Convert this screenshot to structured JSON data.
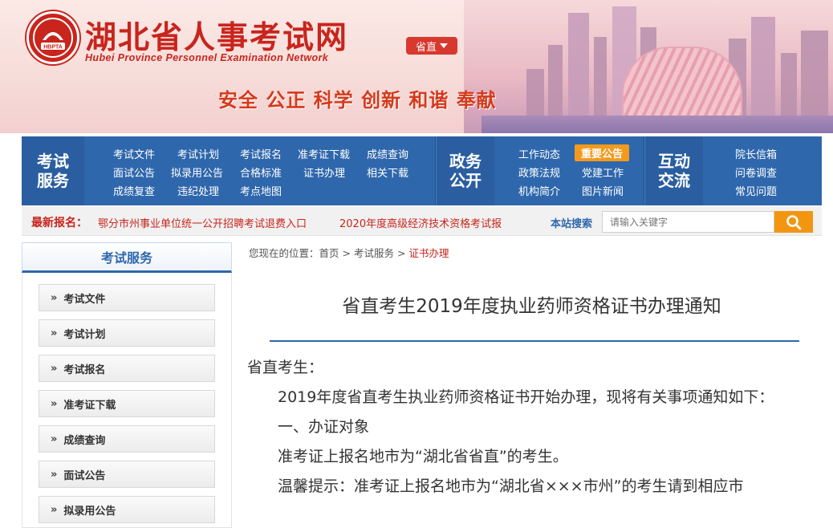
{
  "header": {
    "site_title": "湖北省人事考试网",
    "site_subtitle": "Hubei Province Personnel Examination Network",
    "logo_text": "HBPTA",
    "region_button": "省直",
    "slogan": "安全 公正 科学 创新 和谐 奉献"
  },
  "nav": {
    "groups": [
      {
        "heading": "考试服务",
        "links": [
          "考试文件",
          "考试计划",
          "考试报名",
          "准考证下载",
          "成绩查询",
          "面试公告",
          "拟录用公告",
          "合格标准",
          "证书办理",
          "相关下载",
          "成绩复查",
          "违纪处理",
          "考点地图"
        ]
      },
      {
        "heading": "政务公开",
        "links": [
          "工作动态",
          "重要公告",
          "政策法规",
          "党建工作",
          "机构简介",
          "图片新闻"
        ]
      },
      {
        "heading": "互动交流",
        "links": [
          "院长信箱",
          "问卷调查",
          "常见问题"
        ]
      }
    ]
  },
  "latest": {
    "label": "最新报名：",
    "items": [
      "鄂分市州事业单位统一公开招聘考试退费入口",
      "2020年度高级经济技术资格考试报"
    ]
  },
  "search": {
    "label": "本站搜索",
    "placeholder": "请输入关键字"
  },
  "sidebar": {
    "heading": "考试服务",
    "items": [
      "考试文件",
      "考试计划",
      "考试报名",
      "准考证下载",
      "成绩查询",
      "面试公告",
      "拟录用公告"
    ]
  },
  "breadcrumb": {
    "prefix": "您现在的位置：",
    "items": [
      "首页",
      "考试服务",
      "证书办理"
    ]
  },
  "article": {
    "title": "省直考生2019年度执业药师资格证书办理通知",
    "salutation": "省直考生：",
    "intro": "2019年度省直考生执业药师资格证书开始办理，现将有关事项通知如下：",
    "section1_heading": "一、办证对象",
    "section1_text": "准考证上报名地市为“湖北省省直”的考生。",
    "tip": "温馨提示：准考证上报名地市为“湖北省×××市州”的考生请到相应市"
  },
  "colors": {
    "brand_red": "#c8251d",
    "nav_blue": "#2f67ac",
    "accent_orange": "#f39a1d"
  }
}
